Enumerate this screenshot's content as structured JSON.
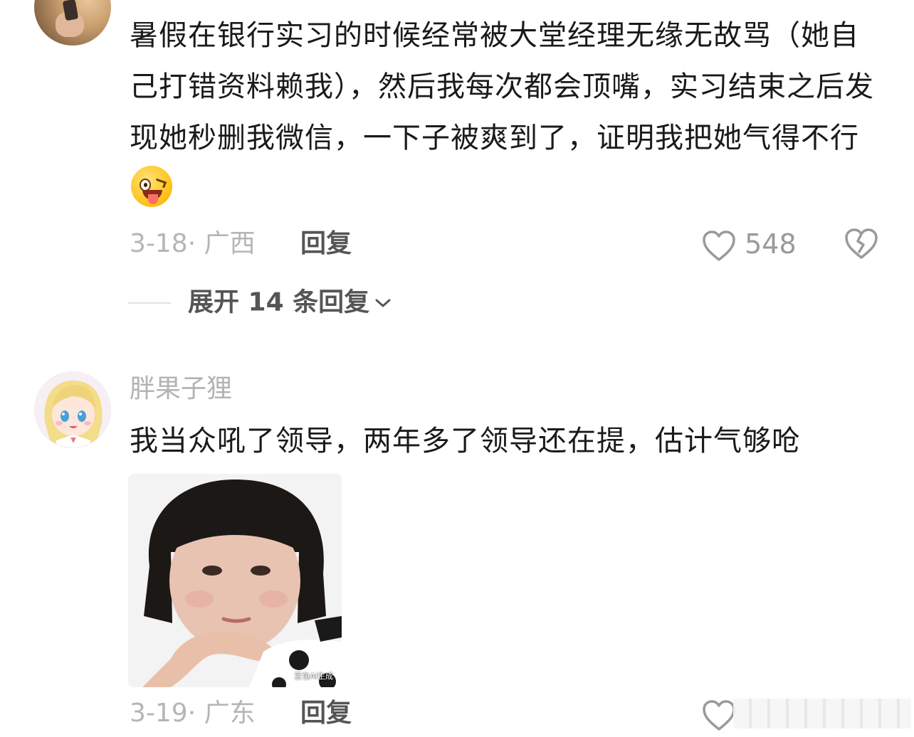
{
  "comments": [
    {
      "text": "暑假在银行实习的时候经常被大堂经理无缘无故骂（她自己打错资料赖我），然后我每次都会顶嘴，实习结束之后发现她秒删我微信，一下子被爽到了，证明我把她气得不行",
      "emoji_icon": "winking-tongue-emoji",
      "date_location": "3-18· 广西",
      "reply_label": "回复",
      "like_count": "548",
      "expand_label": "展开 14 条回复"
    },
    {
      "username": "胖果子狸",
      "text": "我当众吼了领导，两年多了领导还在提，估计气够呛",
      "image_tag": "豆包AI生成",
      "date_location": "3-19· 广东",
      "reply_label": "回复"
    }
  ],
  "icons": {
    "like": "heart-outline-icon",
    "dislike": "broken-heart-icon",
    "expand": "chevron-down-icon"
  },
  "colors": {
    "text": "#1a1a1a",
    "meta": "#b5b5b5",
    "action": "#555555",
    "icon": "#9a9a9a"
  }
}
